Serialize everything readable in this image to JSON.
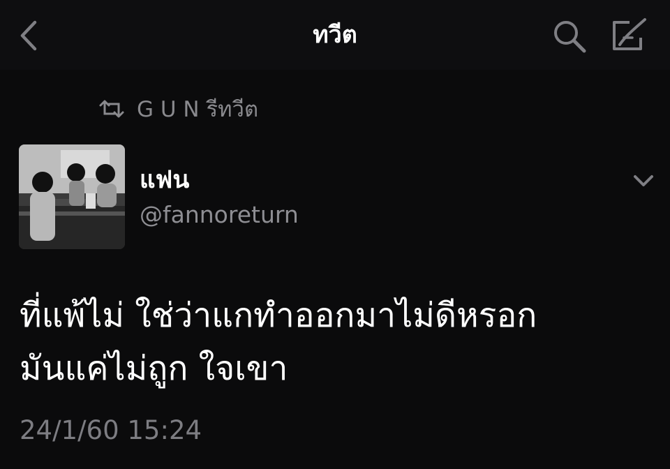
{
  "navbar": {
    "title": "ทวีต",
    "back_icon": "chevron-left-icon",
    "search_icon": "search-icon",
    "compose_icon": "compose-icon"
  },
  "retweet": {
    "icon": "retweet-icon",
    "text": "G U N รีทวีต"
  },
  "tweet": {
    "display_name": "แฟน",
    "handle": "@fannoreturn",
    "menu_icon": "chevron-down-icon",
    "text_lines": [
      "ที่แพ้ไม่ ใช่ว่าแกทำออกมาไม่ดีหรอก",
      "มันแค่ไม่ถูก ใจเขา"
    ],
    "timestamp": "24/1/60 15:24"
  },
  "colors": {
    "background": "#0b0b0c",
    "text_primary": "#ffffff",
    "text_secondary": "#8e8e93"
  }
}
